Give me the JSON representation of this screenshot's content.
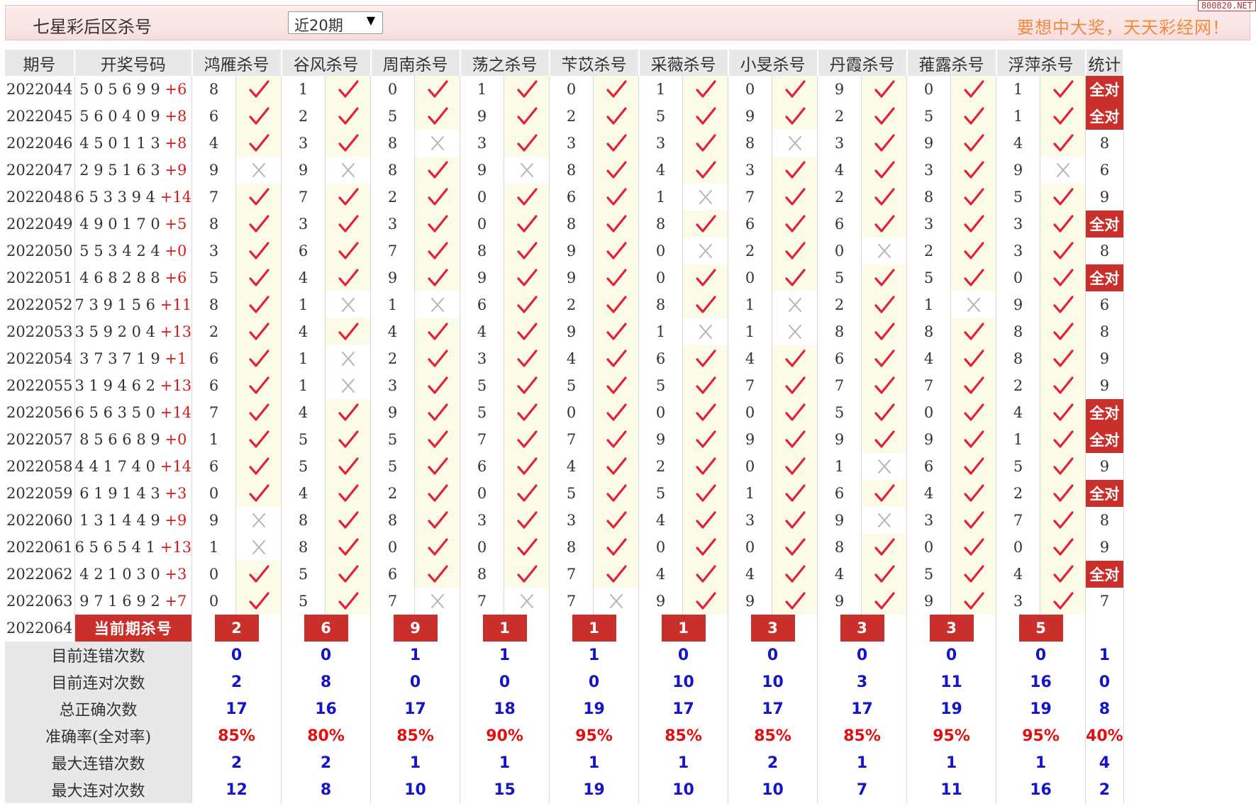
{
  "header": {
    "title": "七星彩后区杀号",
    "select_value": "近20期",
    "select_arrow": "▼",
    "slogan": "要想中大奖，天天彩经网！",
    "logo_text": "800820.NET"
  },
  "columns": {
    "period": "期号",
    "numbers": "开奖号码",
    "experts": [
      "鸿雁杀号",
      "谷风杀号",
      "周南杀号",
      "荡之杀号",
      "苄苡杀号",
      "采薇杀号",
      "小旻杀号",
      "丹霞杀号",
      "蓷露杀号",
      "浮萍杀号"
    ],
    "total": "统计"
  },
  "rows": [
    {
      "period": "2022044",
      "digits": "5 0 5 6 9 9",
      "sum": "+6",
      "kills": [
        8,
        1,
        0,
        1,
        0,
        1,
        0,
        9,
        0,
        1
      ],
      "ok": [
        1,
        1,
        1,
        1,
        1,
        1,
        1,
        1,
        1,
        1
      ],
      "stat": "全对"
    },
    {
      "period": "2022045",
      "digits": "5 6 0 4 0 9",
      "sum": "+8",
      "kills": [
        6,
        2,
        5,
        9,
        2,
        5,
        9,
        2,
        5,
        1
      ],
      "ok": [
        1,
        1,
        1,
        1,
        1,
        1,
        1,
        1,
        1,
        1
      ],
      "stat": "全对"
    },
    {
      "period": "2022046",
      "digits": "4 5 0 1 1 3",
      "sum": "+8",
      "kills": [
        4,
        3,
        8,
        3,
        3,
        3,
        8,
        3,
        9,
        4
      ],
      "ok": [
        1,
        1,
        0,
        1,
        1,
        1,
        0,
        1,
        1,
        1
      ],
      "stat": "8"
    },
    {
      "period": "2022047",
      "digits": "2 9 5 1 6 3",
      "sum": "+9",
      "kills": [
        9,
        9,
        8,
        9,
        8,
        4,
        3,
        4,
        3,
        9
      ],
      "ok": [
        0,
        0,
        1,
        0,
        1,
        1,
        1,
        1,
        1,
        0
      ],
      "stat": "6"
    },
    {
      "period": "2022048",
      "digits": "6 5 3 3 9 4",
      "sum": "+14",
      "kills": [
        7,
        7,
        2,
        0,
        6,
        1,
        7,
        2,
        8,
        5
      ],
      "ok": [
        1,
        1,
        1,
        1,
        1,
        0,
        1,
        1,
        1,
        1
      ],
      "stat": "9"
    },
    {
      "period": "2022049",
      "digits": "4 9 0 1 7 0",
      "sum": "+5",
      "kills": [
        8,
        3,
        3,
        0,
        8,
        8,
        6,
        6,
        3,
        3
      ],
      "ok": [
        1,
        1,
        1,
        1,
        1,
        1,
        1,
        1,
        1,
        1
      ],
      "stat": "全对"
    },
    {
      "period": "2022050",
      "digits": "5 5 3 4 2 4",
      "sum": "+0",
      "kills": [
        3,
        6,
        7,
        8,
        9,
        0,
        2,
        0,
        2,
        3
      ],
      "ok": [
        1,
        1,
        1,
        1,
        1,
        0,
        1,
        0,
        1,
        1
      ],
      "stat": "8"
    },
    {
      "period": "2022051",
      "digits": "4 6 8 2 8 8",
      "sum": "+6",
      "kills": [
        5,
        4,
        9,
        9,
        9,
        0,
        0,
        5,
        5,
        0
      ],
      "ok": [
        1,
        1,
        1,
        1,
        1,
        1,
        1,
        1,
        1,
        1
      ],
      "stat": "全对"
    },
    {
      "period": "2022052",
      "digits": "7 3 9 1 5 6",
      "sum": "+11",
      "kills": [
        8,
        1,
        1,
        6,
        2,
        8,
        1,
        2,
        1,
        9
      ],
      "ok": [
        1,
        0,
        0,
        1,
        1,
        1,
        0,
        1,
        0,
        1
      ],
      "stat": "6"
    },
    {
      "period": "2022053",
      "digits": "3 5 9 2 0 4",
      "sum": "+13",
      "kills": [
        2,
        4,
        4,
        4,
        9,
        1,
        1,
        8,
        8,
        8
      ],
      "ok": [
        1,
        1,
        1,
        1,
        1,
        0,
        0,
        1,
        1,
        1
      ],
      "stat": "8"
    },
    {
      "period": "2022054",
      "digits": "3 7 3 7 1 9",
      "sum": "+1",
      "kills": [
        6,
        1,
        2,
        3,
        4,
        6,
        4,
        6,
        4,
        8
      ],
      "ok": [
        1,
        0,
        1,
        1,
        1,
        1,
        1,
        1,
        1,
        1
      ],
      "stat": "9"
    },
    {
      "period": "2022055",
      "digits": "3 1 9 4 6 2",
      "sum": "+13",
      "kills": [
        6,
        1,
        3,
        5,
        5,
        5,
        7,
        7,
        7,
        2
      ],
      "ok": [
        1,
        0,
        1,
        1,
        1,
        1,
        1,
        1,
        1,
        1
      ],
      "stat": "9"
    },
    {
      "period": "2022056",
      "digits": "6 5 6 3 5 0",
      "sum": "+14",
      "kills": [
        7,
        4,
        9,
        5,
        0,
        0,
        0,
        5,
        0,
        4
      ],
      "ok": [
        1,
        1,
        1,
        1,
        1,
        1,
        1,
        1,
        1,
        1
      ],
      "stat": "全对"
    },
    {
      "period": "2022057",
      "digits": "8 5 6 6 8 9",
      "sum": "+0",
      "kills": [
        1,
        5,
        5,
        7,
        7,
        9,
        9,
        9,
        9,
        1
      ],
      "ok": [
        1,
        1,
        1,
        1,
        1,
        1,
        1,
        1,
        1,
        1
      ],
      "stat": "全对"
    },
    {
      "period": "2022058",
      "digits": "4 4 1 7 4 0",
      "sum": "+14",
      "kills": [
        6,
        5,
        5,
        6,
        4,
        2,
        0,
        1,
        6,
        5
      ],
      "ok": [
        1,
        1,
        1,
        1,
        1,
        1,
        1,
        0,
        1,
        1
      ],
      "stat": "9"
    },
    {
      "period": "2022059",
      "digits": "6 1 9 1 4 3",
      "sum": "+3",
      "kills": [
        0,
        4,
        2,
        0,
        5,
        5,
        1,
        6,
        4,
        2
      ],
      "ok": [
        1,
        1,
        1,
        1,
        1,
        1,
        1,
        1,
        1,
        1
      ],
      "stat": "全对"
    },
    {
      "period": "2022060",
      "digits": "1 3 1 4 4 9",
      "sum": "+9",
      "kills": [
        9,
        8,
        8,
        3,
        3,
        4,
        3,
        9,
        3,
        7
      ],
      "ok": [
        0,
        1,
        1,
        1,
        1,
        1,
        1,
        0,
        1,
        1
      ],
      "stat": "8"
    },
    {
      "period": "2022061",
      "digits": "6 5 6 5 4 1",
      "sum": "+13",
      "kills": [
        1,
        8,
        0,
        0,
        8,
        0,
        0,
        8,
        0,
        0
      ],
      "ok": [
        0,
        1,
        1,
        1,
        1,
        1,
        1,
        1,
        1,
        1
      ],
      "stat": "9"
    },
    {
      "period": "2022062",
      "digits": "4 2 1 0 3 0",
      "sum": "+3",
      "kills": [
        0,
        5,
        6,
        8,
        7,
        4,
        4,
        4,
        5,
        4
      ],
      "ok": [
        1,
        1,
        1,
        1,
        1,
        1,
        1,
        1,
        1,
        1
      ],
      "stat": "全对"
    },
    {
      "period": "2022063",
      "digits": "9 7 1 6 9 2",
      "sum": "+7",
      "kills": [
        0,
        5,
        7,
        7,
        7,
        9,
        9,
        9,
        9,
        3
      ],
      "ok": [
        1,
        1,
        0,
        0,
        0,
        1,
        1,
        1,
        1,
        1
      ],
      "stat": "7"
    }
  ],
  "current": {
    "period": "2022064",
    "label": "当前期杀号",
    "kills": [
      "2",
      "6",
      "9",
      "1",
      "1",
      "1",
      "3",
      "3",
      "3",
      "5"
    ]
  },
  "stats": [
    {
      "label": "目前连错次数",
      "values": [
        "0",
        "0",
        "1",
        "1",
        "1",
        "0",
        "0",
        "0",
        "0",
        "0",
        "1"
      ],
      "color": "blue"
    },
    {
      "label": "目前连对次数",
      "values": [
        "2",
        "8",
        "0",
        "0",
        "0",
        "10",
        "10",
        "3",
        "11",
        "16",
        "0"
      ],
      "color": "blue"
    },
    {
      "label": "总正确次数",
      "values": [
        "17",
        "16",
        "17",
        "18",
        "19",
        "17",
        "17",
        "17",
        "19",
        "19",
        "8"
      ],
      "color": "blue"
    },
    {
      "label": "准确率(全对率)",
      "values": [
        "85%",
        "80%",
        "85%",
        "90%",
        "95%",
        "85%",
        "85%",
        "85%",
        "95%",
        "95%",
        "40%"
      ],
      "color": "red"
    },
    {
      "label": "最大连错次数",
      "values": [
        "2",
        "2",
        "1",
        "1",
        "1",
        "1",
        "2",
        "1",
        "1",
        "1",
        "4"
      ],
      "color": "blue"
    },
    {
      "label": "最大连对次数",
      "values": [
        "12",
        "8",
        "10",
        "15",
        "19",
        "10",
        "10",
        "7",
        "11",
        "16",
        "2"
      ],
      "color": "blue"
    }
  ],
  "colors": {
    "accent": "#c9302c",
    "check": "#e0223a",
    "cross": "#b5b5b5",
    "blue": "#1414c8",
    "red": "#e01010",
    "slogan": "#f08a3c"
  }
}
